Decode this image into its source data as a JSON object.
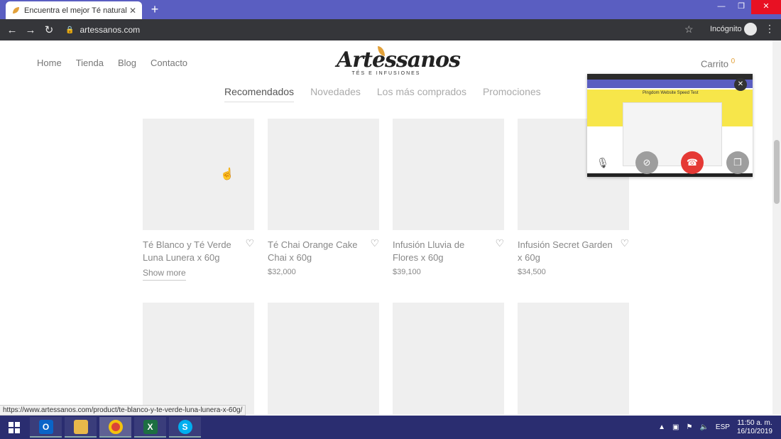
{
  "browser": {
    "tab_title": "Encuentra el mejor Té natural en",
    "tab_close": "✕",
    "new_tab": "+",
    "url": "artessanos.com",
    "incognito_label": "Incógnito",
    "status_url": "https://www.artessanos.com/product/te-blanco-y-te-verde-luna-lunera-x-60g/"
  },
  "header": {
    "nav": [
      "Home",
      "Tienda",
      "Blog",
      "Contacto"
    ],
    "logo_name": "Artessanos",
    "logo_tag": "TÉS E INFUSIONES",
    "cart_label": "Carrito",
    "cart_count": "0"
  },
  "filters": [
    "Recomendados",
    "Novedades",
    "Los más comprados",
    "Promociones"
  ],
  "products": [
    {
      "name": "Té Blanco y Té Verde Luna Lunera x 60g",
      "extra": "Show more"
    },
    {
      "name": "Té Chai Orange Cake Chai x 60g",
      "price": "$32,000"
    },
    {
      "name": "Infusión Lluvia de Flores x 60g",
      "price": "$39,100"
    },
    {
      "name": "Infusión Secret Garden x 60g",
      "price": "$34,500"
    }
  ],
  "pip": {
    "title": "Pingdom Website Speed Test"
  },
  "taskbar": {
    "lang": "ESP",
    "time": "11:50 a. m.",
    "date": "16/10/2019"
  },
  "colors": {
    "tabbar": "#5a5ec1",
    "toolbar": "#35363a",
    "taskbar": "#2a2d70",
    "accent": "#e2a13a"
  }
}
